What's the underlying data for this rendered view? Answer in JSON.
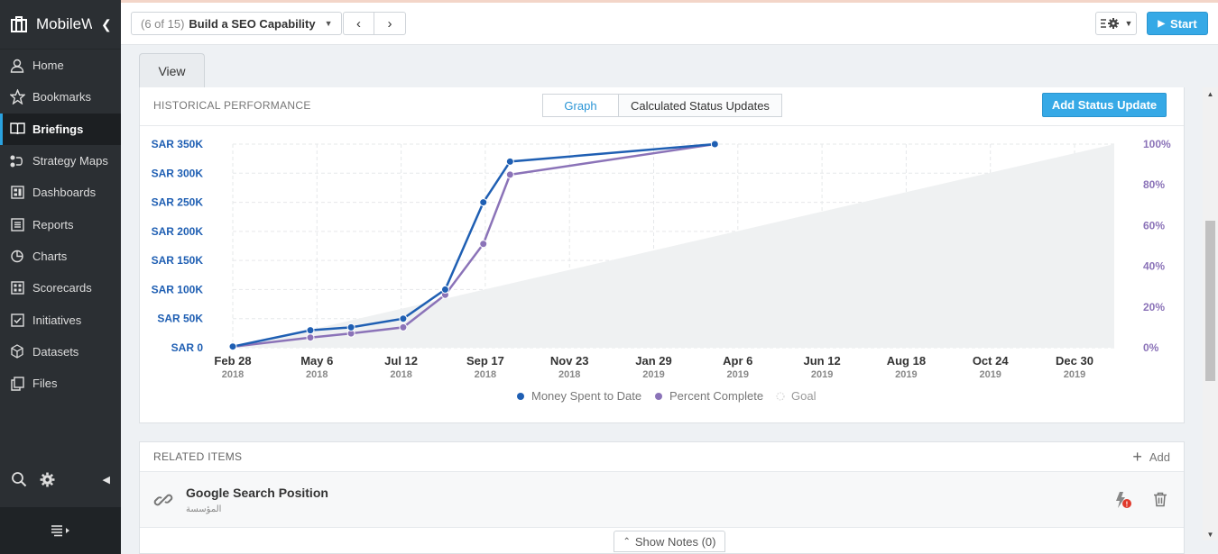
{
  "app": {
    "name": "MobileWorks"
  },
  "sidebar": {
    "items": [
      {
        "label": "Home",
        "icon": "person-icon"
      },
      {
        "label": "Bookmarks",
        "icon": "star-icon"
      },
      {
        "label": "Briefings",
        "icon": "book-icon",
        "active": true
      },
      {
        "label": "Strategy Maps",
        "icon": "strategy-map-icon"
      },
      {
        "label": "Dashboards",
        "icon": "dashboard-icon"
      },
      {
        "label": "Reports",
        "icon": "report-icon"
      },
      {
        "label": "Charts",
        "icon": "pie-chart-icon"
      },
      {
        "label": "Scorecards",
        "icon": "scorecard-icon"
      },
      {
        "label": "Initiatives",
        "icon": "checkbox-icon"
      },
      {
        "label": "Datasets",
        "icon": "cube-icon"
      },
      {
        "label": "Files",
        "icon": "files-icon"
      }
    ]
  },
  "toolbar": {
    "count": "(6 of 15)",
    "title": "Build a SEO Capability",
    "start_label": "Start"
  },
  "tabs": [
    {
      "label": "View"
    }
  ],
  "panel": {
    "title": "HISTORICAL PERFORMANCE",
    "seg_graph": "Graph",
    "seg_calc": "Calculated Status Updates",
    "add_status": "Add Status Update"
  },
  "chart_data": {
    "type": "line",
    "x_ticks": [
      {
        "label": "Feb 28",
        "year": "2018"
      },
      {
        "label": "May 6",
        "year": "2018"
      },
      {
        "label": "Jul 12",
        "year": "2018"
      },
      {
        "label": "Sep 17",
        "year": "2018"
      },
      {
        "label": "Nov 23",
        "year": "2018"
      },
      {
        "label": "Jan 29",
        "year": "2019"
      },
      {
        "label": "Apr 6",
        "year": "2019"
      },
      {
        "label": "Jun 12",
        "year": "2019"
      },
      {
        "label": "Aug 18",
        "year": "2019"
      },
      {
        "label": "Oct 24",
        "year": "2019"
      },
      {
        "label": "Dec 30",
        "year": "2019"
      }
    ],
    "y_left_ticks": [
      "SAR 0",
      "SAR 50K",
      "SAR 100K",
      "SAR 150K",
      "SAR 200K",
      "SAR 250K",
      "SAR 300K",
      "SAR 350K"
    ],
    "y_right_ticks": [
      "0%",
      "20%",
      "40%",
      "60%",
      "80%",
      "100%"
    ],
    "ylim_left": [
      0,
      350000
    ],
    "ylim_right": [
      0,
      100
    ],
    "series": [
      {
        "name": "Money Spent to Date",
        "color": "#1f5fb3",
        "x": [
          "2018-02-28",
          "2018-04-30",
          "2018-06-01",
          "2018-07-12",
          "2018-08-14",
          "2018-09-13",
          "2018-10-04",
          "2019-03-14"
        ],
        "values": [
          2000,
          30000,
          35000,
          50000,
          100000,
          250000,
          320000,
          350000
        ]
      },
      {
        "name": "Percent Complete",
        "color": "#8b73b8",
        "x": [
          "2018-02-28",
          "2018-04-30",
          "2018-06-01",
          "2018-07-12",
          "2018-08-14",
          "2018-09-13",
          "2018-10-04",
          "2019-03-14"
        ],
        "values": [
          0.5,
          5,
          7,
          10,
          26,
          51,
          85,
          100
        ]
      },
      {
        "name": "Goal",
        "color": "#f0f2f3",
        "x": [
          "2018-02-28",
          "2020-01-22"
        ],
        "values": [
          0,
          100
        ]
      }
    ]
  },
  "related": {
    "title": "RELATED ITEMS",
    "add_label": "Add",
    "items": [
      {
        "name": "Google Search Position",
        "sub": "المؤسسة"
      }
    ]
  },
  "notes": {
    "label": "Show Notes (0)"
  }
}
